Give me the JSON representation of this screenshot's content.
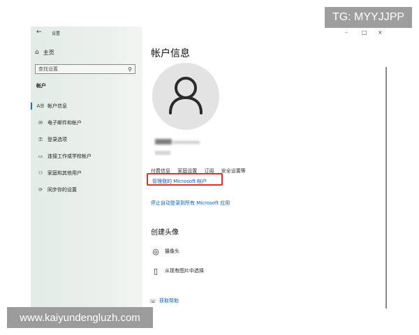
{
  "window": {
    "title": "设置",
    "minimize_glyph": "–",
    "maximize_glyph": "□",
    "close_glyph": "×"
  },
  "watermarks": {
    "top_right": "TG: MYYJJPP",
    "bottom": "www.kaiyundengluzh.com"
  },
  "sidebar": {
    "home_label": "主页",
    "search_placeholder": "查找设置",
    "section_title": "帐户",
    "items": [
      {
        "label": "帐户信息",
        "icon": "person-card-icon",
        "glyph": "A☰",
        "active": true
      },
      {
        "label": "电子邮件和帐户",
        "icon": "mail-icon",
        "glyph": "✉",
        "active": false
      },
      {
        "label": "登录选项",
        "icon": "key-icon",
        "glyph": "⚿",
        "active": false
      },
      {
        "label": "连接工作或学校帐户",
        "icon": "briefcase-icon",
        "glyph": "▭",
        "active": false
      },
      {
        "label": "家庭和其他用户",
        "icon": "person-add-icon",
        "glyph": "⚇",
        "active": false
      },
      {
        "label": "同步你的设置",
        "icon": "sync-icon",
        "glyph": "⟳",
        "active": false
      }
    ]
  },
  "main": {
    "heading": "帐户信息",
    "links_row": [
      "付费信息",
      "家庭设置",
      "订阅",
      "安全设置等"
    ],
    "manage_link": "管理我的 Microsoft 帐户",
    "stop_link": "停止自动登录到所有 Microsoft 应用",
    "create_avatar_heading": "创建头像",
    "camera_label": "摄像头",
    "browse_label": "从现有图片中选择",
    "help_label": "获取帮助"
  },
  "colors": {
    "link": "#0a5fb4",
    "highlight_box": "#d9302f",
    "accent": "#0a6ed1"
  }
}
